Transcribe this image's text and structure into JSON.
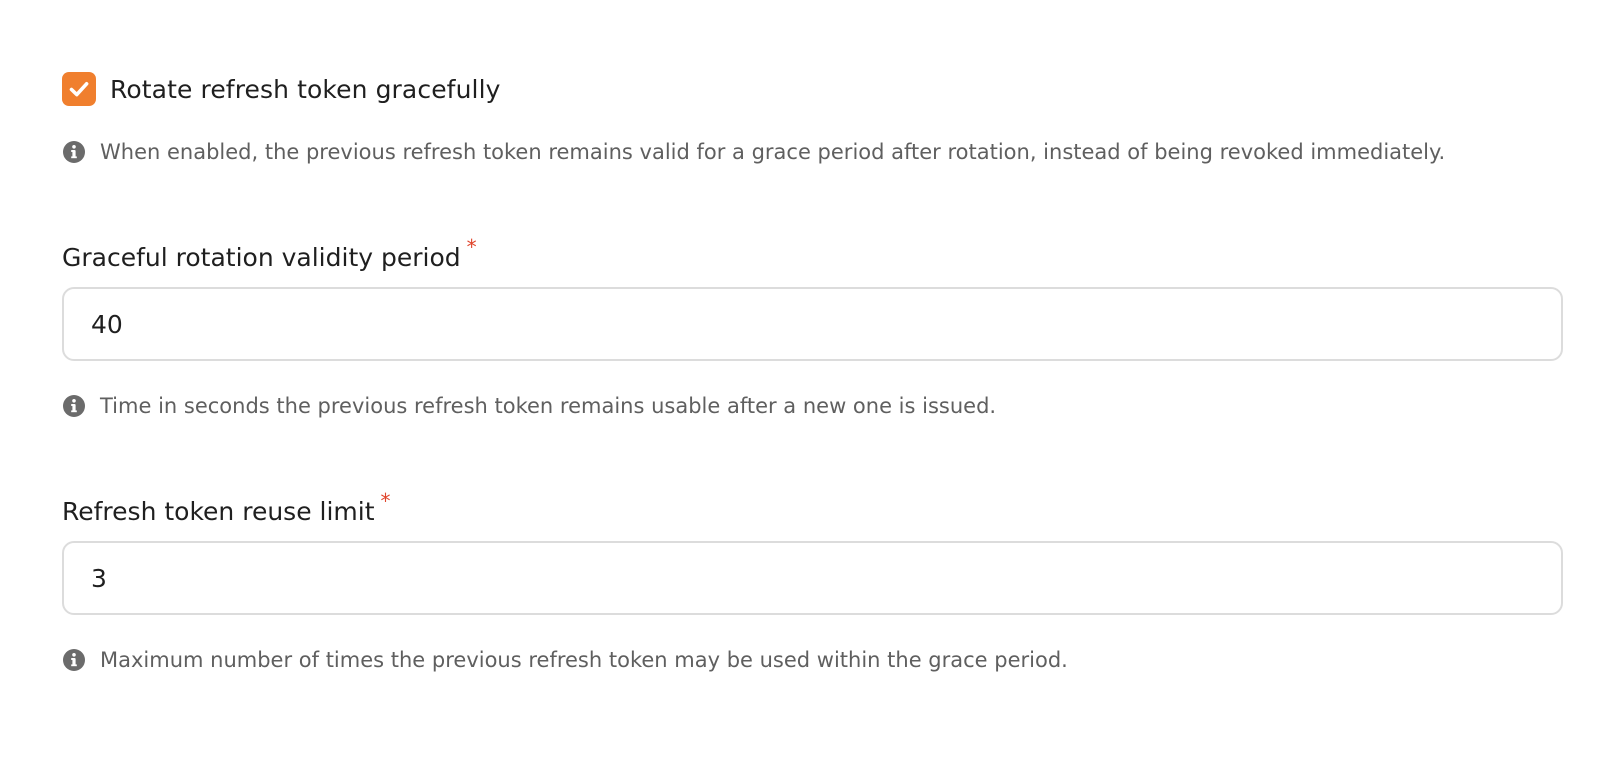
{
  "rotate_checkbox": {
    "label": "Rotate refresh token gracefully",
    "checked": true,
    "accent_color": "#f07f2e",
    "hint": "When enabled, the previous refresh token remains valid for a grace period after rotation, instead of being revoked immediately."
  },
  "validity_period": {
    "label": "Graceful rotation validity period",
    "required_marker": "*",
    "value": "40",
    "hint": "Time in seconds the previous refresh token remains usable after a new one is issued."
  },
  "reuse_limit": {
    "label": "Refresh token reuse limit",
    "required_marker": "*",
    "value": "3",
    "hint": "Maximum number of times the previous refresh token may be used within the grace period."
  },
  "icons": {
    "checkbox": "checkmark-icon",
    "hint": "info-icon"
  },
  "colors": {
    "required": "#e0452c",
    "hint_text": "#5f5f5f",
    "input_border": "#dcdcdc"
  }
}
